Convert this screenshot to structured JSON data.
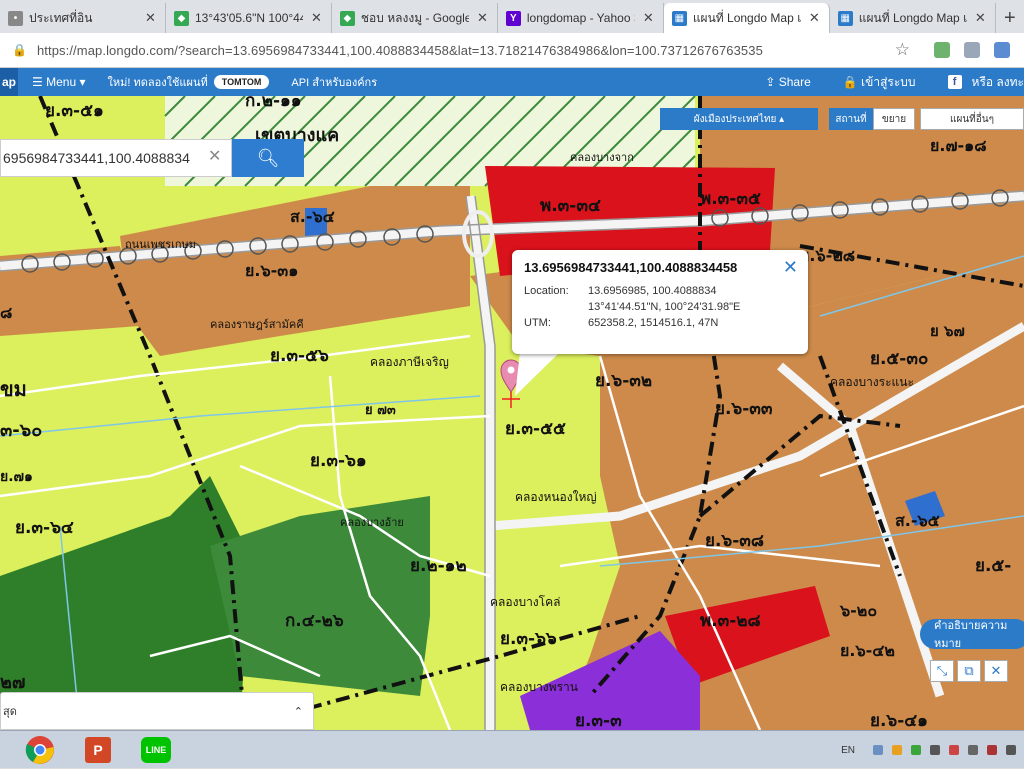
{
  "tabs": [
    {
      "label": "ประเทศที่อิน",
      "icon": "page-icon",
      "active": false
    },
    {
      "label": "13°43'05.6\"N 100°44'",
      "icon": "google-maps-icon",
      "active": false
    },
    {
      "label": "ชอบ หลงงมู - Google M",
      "icon": "google-maps-icon",
      "active": false
    },
    {
      "label": "longdomap - Yahoo S",
      "icon": "yahoo-icon",
      "active": false
    },
    {
      "label": "แผนที่ Longdo Map แผ",
      "icon": "longdo-icon",
      "active": true
    },
    {
      "label": "แผนที่ Longdo Map แผ",
      "icon": "longdo-icon",
      "active": false
    }
  ],
  "address_bar": {
    "url": "https://map.longdo.com/?search=13.6956984733441,100.4088834458&lat=13.71821476384986&lon=100.73712676763535"
  },
  "nav": {
    "logo": "ap",
    "menu_label": "Menu",
    "new_feature": "ใหม่! ทดลองใช้แผนที่",
    "tomtom": "TOMTOM",
    "api_label": "API สำหรับองค์กร",
    "share_label": "Share",
    "login_label": "เข้าสู่ระบบ",
    "fb_label": "f",
    "or_label": "หรือ ลงทะ"
  },
  "search": {
    "value": "6956984733441,100.4088834"
  },
  "map_toolbar": {
    "region_select": "ผังเมืองประเทศไทย",
    "place_label": "สถานที่",
    "mode_select": "ขยาย",
    "other_maps": "แผนที่อื่นๆ"
  },
  "popup": {
    "title": "13.6956984733441,100.4088834458",
    "location_label": "Location:",
    "location_value": "13.6956985, 100.4088834",
    "dms_value": "13°41'44.51\"N, 100°24'31.98\"E",
    "utm_label": "UTM:",
    "utm_value": "652358.2, 1514516.1, 47N"
  },
  "legend_button": "คำอธิบายความหมาย",
  "bottom_panel": {
    "label": "สุด"
  },
  "map_labels": [
    "ย.๓-๕๑",
    "ก.๒-๑๑",
    "เขตบางแค",
    "คลองบางจาก",
    "พ.๓-๓๔",
    "พ.๓-๓๕",
    "ส.-๖๔",
    "ถนนเพชรเกษม",
    "ย.๗-๑๘",
    "ย.๖-๓๑",
    "ย.๖-๒๘",
    "๘",
    "คลองราษฎร์สามัคคี",
    "ย.๓-๕๖",
    "คลองภาษีเจริญ",
    "ขม",
    "๓-๖๐",
    "ย.๖-๓๒",
    "ย.๕-๓๐",
    "ย.๖-๓๓",
    "ย.๓-๕๕",
    "คลองบางระแนะ",
    "ย.๓-๖๑",
    "ย.๗๑",
    "ย.๓-๖๔",
    "คลองหนองใหญ่",
    "ส.-๖๕",
    "คลองบางอ้าย",
    "ย.๒-๑๒",
    "ย.๖-๓๘",
    "ย.๕-",
    "ก.๔-๒๖",
    "คลองบางโคล่",
    "พ.๓-๒๘",
    "๖-๒๐",
    "ย.๓-๖๖",
    "ย.๖-๔๒",
    "คลองบางพราน",
    "๒๗",
    "ย.๓-๓",
    "ย.๖-๔๑",
    "ย ๖๗",
    "ย ๗๓"
  ],
  "taskbar": {
    "lang": "EN",
    "apps": [
      "chrome-icon",
      "powerpoint-icon",
      "line-icon"
    ],
    "line_label": "LINE",
    "ppt_label": "P"
  },
  "colors": {
    "yellow_zone": "#dcef5c",
    "orange_zone": "#cd8a4a",
    "red_zone": "#d9121b",
    "purple_zone": "#8b2fd9",
    "green_zone": "#3c8a3a",
    "brand_blue": "#2c7bc9"
  }
}
